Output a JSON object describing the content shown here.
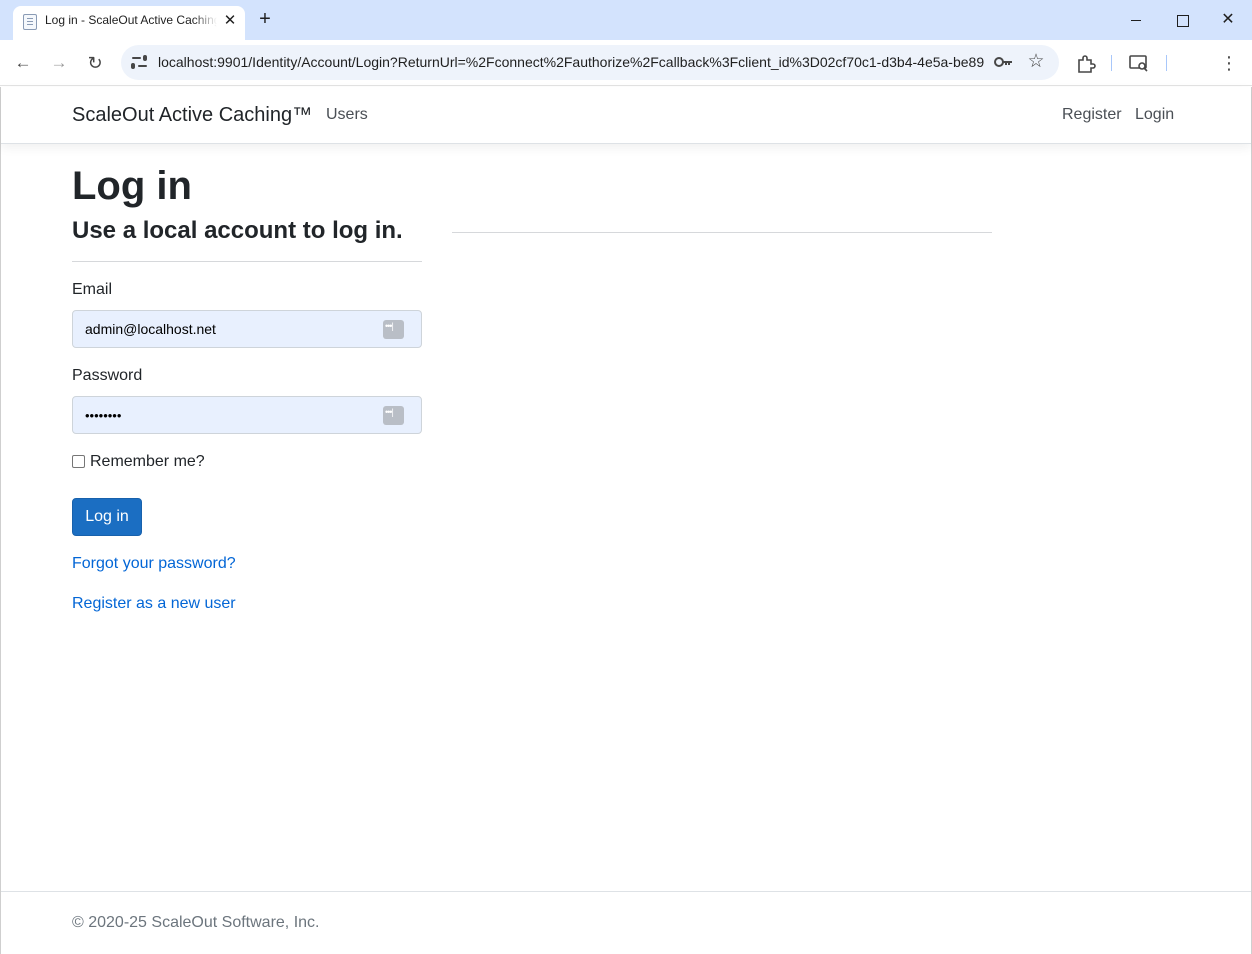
{
  "browser": {
    "tab_title": "Log in - ScaleOut Active Caching™",
    "new_tab": "+",
    "close_tab": "✕",
    "url": "localhost:9901/Identity/Account/Login?ReturnUrl=%2Fconnect%2Fauthorize%2Fcallback%3Fclient_id%3D02cf70c1-d3b4-4e5a-be89..."
  },
  "navbar": {
    "brand": "ScaleOut Active Caching™",
    "users": "Users",
    "register": "Register",
    "login": "Login"
  },
  "main": {
    "title": "Log in",
    "subtitle": "Use a local account to log in.",
    "email_label": "Email",
    "email_value": "admin@localhost.net",
    "password_label": "Password",
    "password_value": "••••••••",
    "remember_label": "Remember me?",
    "login_button": "Log in",
    "forgot_link": "Forgot your password?",
    "register_link": "Register as a new user"
  },
  "footer": {
    "text": "© 2020-25 ScaleOut Software, Inc."
  },
  "colors": {
    "primary": "#1b6ec2",
    "link": "#0366d6",
    "autofill_bg": "#e8f0fe"
  },
  "icons": [
    "page-icon",
    "close-icon",
    "plus-icon",
    "minimize-icon",
    "maximize-icon",
    "back-arrow-icon",
    "forward-arrow-icon",
    "reload-icon",
    "site-info-icon",
    "key-icon",
    "star-icon",
    "extensions-icon",
    "cast-icon",
    "kebab-menu-icon",
    "password-manager-icon"
  ]
}
